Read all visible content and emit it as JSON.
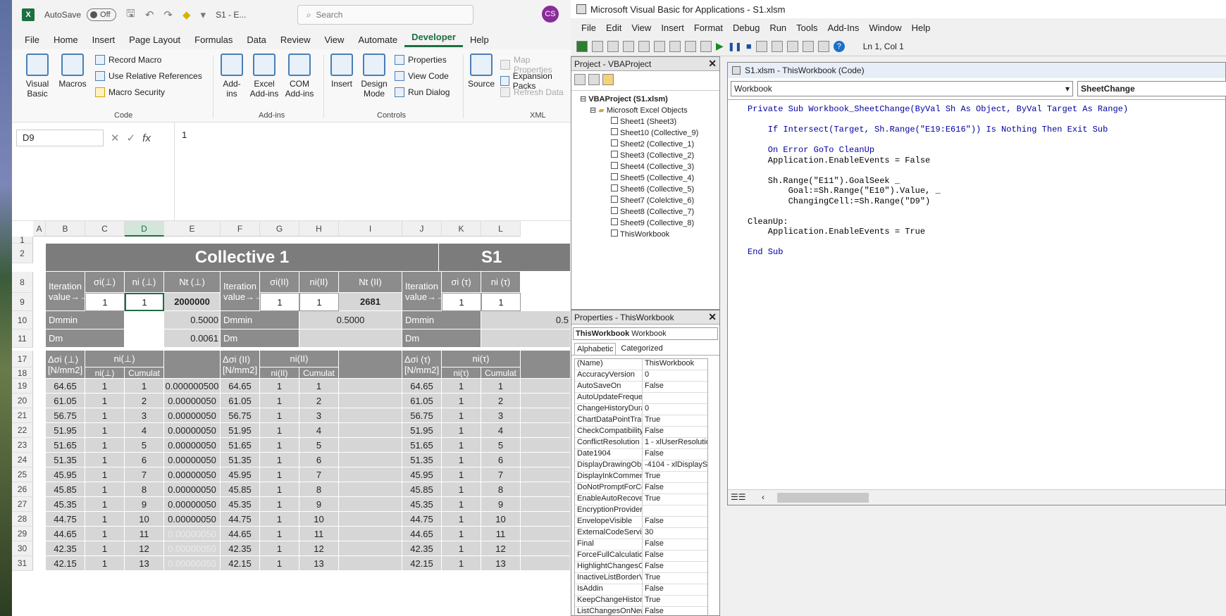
{
  "excel": {
    "titlebar": {
      "autosave": "AutoSave",
      "toggle": "Off",
      "filename": "S1 - E...",
      "search_placeholder": "Search",
      "avatar": "CS"
    },
    "menu": [
      "File",
      "Home",
      "Insert",
      "Page Layout",
      "Formulas",
      "Data",
      "Review",
      "View",
      "Automate",
      "Developer",
      "Help"
    ],
    "menu_active": "Developer",
    "ribbon": {
      "code_group": "Code",
      "visual_basic": "Visual Basic",
      "macros": "Macros",
      "record_macro": "Record Macro",
      "use_relative": "Use Relative References",
      "macro_security": "Macro Security",
      "addins_group": "Add-ins",
      "addins": "Add-ins",
      "excel_addins": "Excel Add-ins",
      "com_addins": "COM Add-ins",
      "controls_group": "Controls",
      "insert": "Insert",
      "design_mode": "Design Mode",
      "properties": "Properties",
      "view_code": "View Code",
      "run_dialog": "Run Dialog",
      "xml_group": "XML",
      "source": "Source",
      "map_properties": "Map Properties",
      "expansion_packs": "Expansion Packs",
      "refresh_data": "Refresh Data"
    },
    "formula_bar": {
      "namebox": "D9",
      "fx": "fx",
      "formula": "1"
    },
    "columns": [
      "A",
      "B",
      "C",
      "D",
      "E",
      "F",
      "G",
      "H",
      "I",
      "J",
      "K",
      "L"
    ],
    "header_title_1": "Collective 1",
    "header_title_2": "S1",
    "iteration_label": "Iteration value→→",
    "headers_perp": [
      "σi(⊥)",
      "ni (⊥)",
      "Nt (⊥)"
    ],
    "headers_par": [
      "σi(II)",
      "ni(II)",
      "Nt (II)"
    ],
    "headers_tau": [
      "σi (τ)",
      "ni (τ)"
    ],
    "row9": {
      "c": "1",
      "d": "1",
      "e": "2000000",
      "g": "1",
      "h": "1",
      "i": "2681",
      "k": "1",
      "l": "1"
    },
    "dmmin_label": "Dmmin",
    "dm_label": "Dm",
    "dmmin_e": "0.5000",
    "dm_e": "0.0061",
    "dmmin_i": "0.5000",
    "dmmin_l": "0.5",
    "sec17_perp": {
      "ds": "Δσi (⊥)\n[N/mm2]",
      "ni": "ni(⊥)",
      "sub1": "ni(⊥)",
      "sub2": "Cumulat"
    },
    "sec17_par": {
      "ds": "Δσi (II)\n[N/mm2]",
      "ni": "ni(II)",
      "sub1": "ni(II)",
      "sub2": "Cumulat"
    },
    "sec17_tau": {
      "ds": "Δσi (τ)\n[N/mm2]",
      "ni": "ni(τ)",
      "sub1": "ni(τ)",
      "sub2": "Cumulat"
    },
    "rows": [
      {
        "r": "19",
        "s": "64.65",
        "n": "1",
        "c": "1",
        "e": "0.000000500"
      },
      {
        "r": "20",
        "s": "61.05",
        "n": "1",
        "c": "2",
        "e": "0.00000050"
      },
      {
        "r": "21",
        "s": "56.75",
        "n": "1",
        "c": "3",
        "e": "0.00000050"
      },
      {
        "r": "22",
        "s": "51.95",
        "n": "1",
        "c": "4",
        "e": "0.00000050"
      },
      {
        "r": "23",
        "s": "51.65",
        "n": "1",
        "c": "5",
        "e": "0.00000050"
      },
      {
        "r": "24",
        "s": "51.35",
        "n": "1",
        "c": "6",
        "e": "0.00000050"
      },
      {
        "r": "25",
        "s": "45.95",
        "n": "1",
        "c": "7",
        "e": "0.00000050"
      },
      {
        "r": "26",
        "s": "45.85",
        "n": "1",
        "c": "8",
        "e": "0.00000050"
      },
      {
        "r": "27",
        "s": "45.35",
        "n": "1",
        "c": "9",
        "e": "0.00000050"
      },
      {
        "r": "28",
        "s": "44.75",
        "n": "1",
        "c": "10",
        "e": "0.00000050"
      },
      {
        "r": "29",
        "s": "44.65",
        "n": "1",
        "c": "11",
        "e": "0.00000050"
      },
      {
        "r": "30",
        "s": "42.35",
        "n": "1",
        "c": "12",
        "e": "0.00000050"
      },
      {
        "r": "31",
        "s": "42.15",
        "n": "1",
        "c": "13",
        "e": "0.00000050"
      }
    ]
  },
  "vba": {
    "title": "Microsoft Visual Basic for Applications - S1.xlsm",
    "menu": [
      "File",
      "Edit",
      "View",
      "Insert",
      "Format",
      "Debug",
      "Run",
      "Tools",
      "Add-Ins",
      "Window",
      "Help"
    ],
    "lncol": "Ln 1, Col 1",
    "project_title": "Project - VBAProject",
    "tree": {
      "root": "VBAProject (S1.xlsm)",
      "folder": "Microsoft Excel Objects",
      "items": [
        "Sheet1 (Sheet3)",
        "Sheet10 (Collective_9)",
        "Sheet2 (Collective_1)",
        "Sheet3 (Collective_2)",
        "Sheet4 (Collective_3)",
        "Sheet5 (Collective_4)",
        "Sheet6 (Collective_5)",
        "Sheet7 (Colelctive_6)",
        "Sheet8 (Collective_7)",
        "Sheet9 (Collective_8)",
        "ThisWorkbook"
      ]
    },
    "props_title": "Properties - ThisWorkbook",
    "props_object": "ThisWorkbook",
    "props_object_type": "Workbook",
    "props_tabs": [
      "Alphabetic",
      "Categorized"
    ],
    "props": [
      [
        "(Name)",
        "ThisWorkbook"
      ],
      [
        "AccuracyVersion",
        "0"
      ],
      [
        "AutoSaveOn",
        "False"
      ],
      [
        "AutoUpdateFrequer",
        ""
      ],
      [
        "ChangeHistoryDura",
        "0"
      ],
      [
        "ChartDataPointTrac",
        "True"
      ],
      [
        "CheckCompatibility",
        "False"
      ],
      [
        "ConflictResolution",
        "1 - xlUserResolutio"
      ],
      [
        "Date1904",
        "False"
      ],
      [
        "DisplayDrawingObje",
        "-4104 - xlDisplaySh"
      ],
      [
        "DisplayInkComment",
        "True"
      ],
      [
        "DoNotPromptForCo",
        "False"
      ],
      [
        "EnableAutoRecover",
        "True"
      ],
      [
        "EncryptionProvider",
        ""
      ],
      [
        "EnvelopeVisible",
        "False"
      ],
      [
        "ExternalCodeServic",
        "30"
      ],
      [
        "Final",
        "False"
      ],
      [
        "ForceFullCalculation",
        "False"
      ],
      [
        "HighlightChangesOr",
        "False"
      ],
      [
        "InactiveListBorderVi",
        "True"
      ],
      [
        "IsAddin",
        "False"
      ],
      [
        "KeepChangeHistory",
        "True"
      ],
      [
        "ListChangesOnNew",
        "False"
      ]
    ],
    "code_title": "S1.xlsm - ThisWorkbook (Code)",
    "combo_left": "Workbook",
    "combo_right": "SheetChange",
    "code_lines": [
      "Private Sub Workbook_SheetChange(ByVal Sh As Object, ByVal Target As Range)",
      "",
      "    If Intersect(Target, Sh.Range(\"E19:E616\")) Is Nothing Then Exit Sub",
      "",
      "    On Error GoTo CleanUp",
      "    Application.EnableEvents = False",
      "",
      "    Sh.Range(\"E11\").GoalSeek _",
      "        Goal:=Sh.Range(\"E10\").Value, _",
      "        ChangingCell:=Sh.Range(\"D9\")",
      "",
      "CleanUp:",
      "    Application.EnableEvents = True",
      "",
      "End Sub"
    ]
  }
}
